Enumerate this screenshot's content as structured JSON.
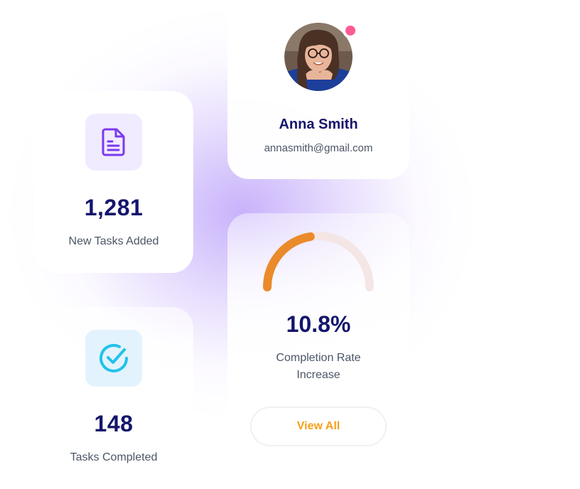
{
  "tasks_added": {
    "value": "1,281",
    "label": "New Tasks Added",
    "icon": "document-icon",
    "accent": "#7c3aed"
  },
  "tasks_completed": {
    "value": "148",
    "label": "Tasks Completed",
    "icon": "check-circle-icon",
    "accent": "#22c2ec"
  },
  "profile": {
    "name": "Anna Smith",
    "email": "annasmith@gmail.com",
    "status_color": "#ff5a94"
  },
  "completion": {
    "value": "10.8%",
    "label": "Completion Rate Increase",
    "gauge_fraction": 0.45,
    "gauge_color": "#ea8a2a",
    "track_color": "#f5e6e6",
    "button_label": "View All"
  }
}
